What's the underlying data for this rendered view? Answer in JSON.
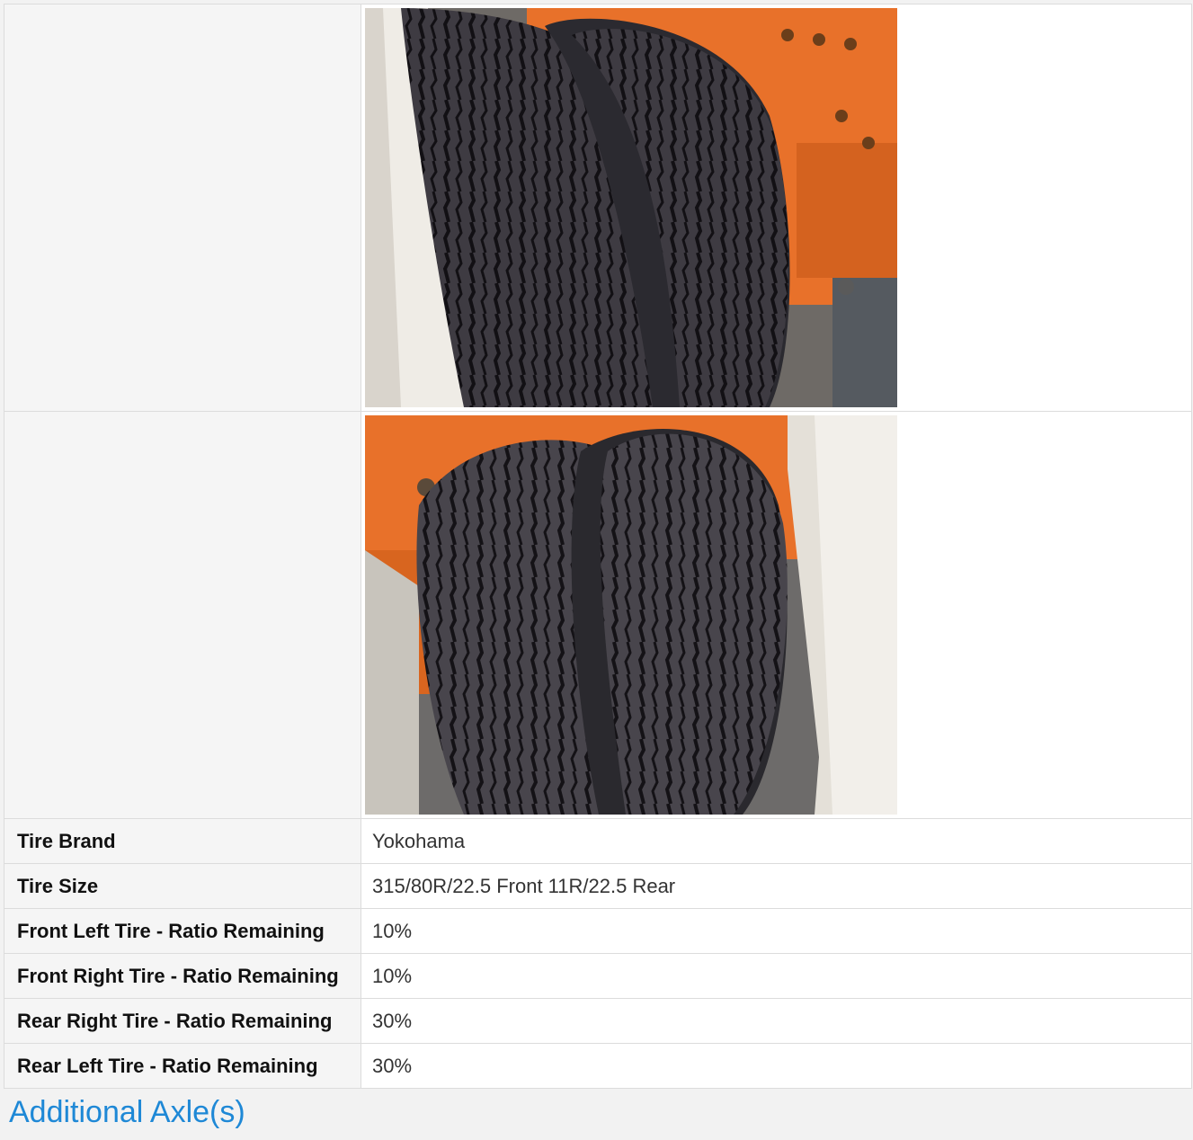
{
  "photos": [
    {
      "icon": "tire-photo-front"
    },
    {
      "icon": "tire-photo-rear"
    }
  ],
  "rows": [
    {
      "label": "Tire Brand",
      "value": "Yokohama"
    },
    {
      "label": "Tire Size",
      "value": "315/80R/22.5 Front 11R/22.5 Rear"
    },
    {
      "label": "Front Left Tire - Ratio Remaining",
      "value": "10%"
    },
    {
      "label": "Front Right Tire - Ratio Remaining",
      "value": "10%"
    },
    {
      "label": "Rear Right Tire - Ratio Remaining",
      "value": "30%"
    },
    {
      "label": "Rear Left Tire - Ratio Remaining",
      "value": "30%"
    }
  ],
  "section": {
    "title": "Additional Axle(s)"
  },
  "colors": {
    "accent": "#1e88d6",
    "truck_orange": "#e8712a"
  }
}
